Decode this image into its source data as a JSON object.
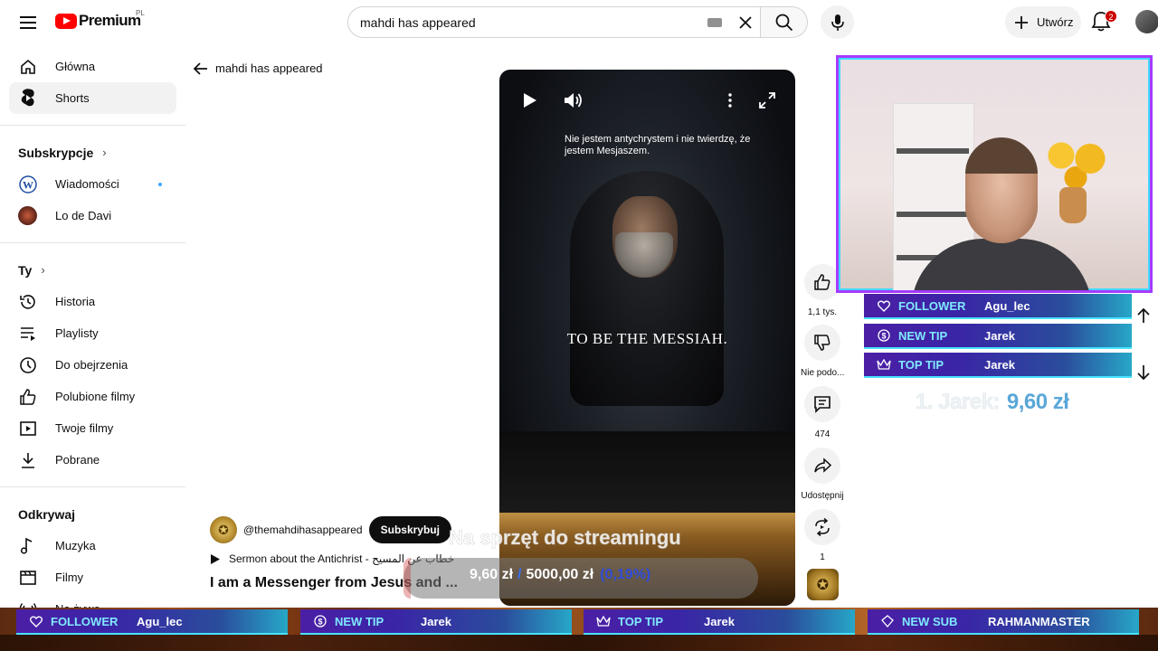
{
  "header": {
    "logo_text": "Premium",
    "logo_country": "PL",
    "search_value": "mahdi has appeared",
    "create_label": "Utwórz",
    "notification_count": "2"
  },
  "sidebar": {
    "main": [
      {
        "label": "Główna",
        "icon": "home-icon"
      },
      {
        "label": "Shorts",
        "icon": "shorts-icon",
        "active": true
      }
    ],
    "subscriptions_title": "Subskrypcje",
    "subscriptions": [
      {
        "label": "Wiadomości",
        "icon": "wordpress-icon"
      },
      {
        "label": "Lo de Davi",
        "icon": "channel-avatar"
      }
    ],
    "you_title": "Ty",
    "you": [
      {
        "label": "Historia",
        "icon": "history-icon"
      },
      {
        "label": "Playlisty",
        "icon": "playlist-icon"
      },
      {
        "label": "Do obejrzenia",
        "icon": "clock-icon"
      },
      {
        "label": "Polubione filmy",
        "icon": "thumbs-up-icon"
      },
      {
        "label": "Twoje filmy",
        "icon": "video-icon"
      },
      {
        "label": "Pobrane",
        "icon": "download-icon"
      }
    ],
    "explore_title": "Odkrywaj",
    "explore": [
      {
        "label": "Muzyka",
        "icon": "music-icon"
      },
      {
        "label": "Filmy",
        "icon": "film-icon"
      },
      {
        "label": "Na żywo",
        "icon": "live-icon"
      }
    ]
  },
  "shorts": {
    "back_label": "mahdi has appeared",
    "subtitle_top": "Nie jestem antychrystem i nie twierdzę, że jestem Mesjaszem.",
    "subtitle_mid": "TO BE THE MESSIAH.",
    "channel_name": "@themahdihasappeared",
    "subscribe_label": "Subskrybuj",
    "sermon_label": "Sermon about the Antichrist - خطاب عن المسيح",
    "title": "I am a Messenger from Jesus and ...",
    "actions": [
      {
        "icon": "thumbs-up-icon",
        "label": "1,1 tys."
      },
      {
        "icon": "thumbs-down-icon",
        "label": "Nie podo..."
      },
      {
        "icon": "comment-icon",
        "label": "474"
      },
      {
        "icon": "share-icon",
        "label": "Udostępnij"
      },
      {
        "icon": "remix-icon",
        "label": "1"
      }
    ]
  },
  "overlay": {
    "cam_alerts": [
      {
        "key": "FOLLOWER",
        "value": "Agu_lec",
        "icon": "heart-icon"
      },
      {
        "key": "NEW TIP",
        "value": "Jarek",
        "icon": "dollar-icon"
      },
      {
        "key": "TOP TIP",
        "value": "Jarek",
        "icon": "crown-icon"
      }
    ],
    "leader_name": "1. Jarek:",
    "leader_amount": "9,60 zł",
    "goal_title": "Na sprzęt do streamingu",
    "goal_current": "9,60 zł",
    "goal_sep": "/",
    "goal_target": "5000,00 zł",
    "goal_percent": "(0,19%)",
    "goal_fraction": 0.0019,
    "bottom_alerts": [
      {
        "key": "FOLLOWER",
        "value": "Agu_lec",
        "icon": "heart-icon"
      },
      {
        "key": "NEW TIP",
        "value": "Jarek",
        "icon": "dollar-icon"
      },
      {
        "key": "TOP TIP",
        "value": "Jarek",
        "icon": "crown-icon"
      },
      {
        "key": "NEW SUB",
        "value": "RAHMANMASTER",
        "icon": "diamond-icon"
      }
    ]
  }
}
